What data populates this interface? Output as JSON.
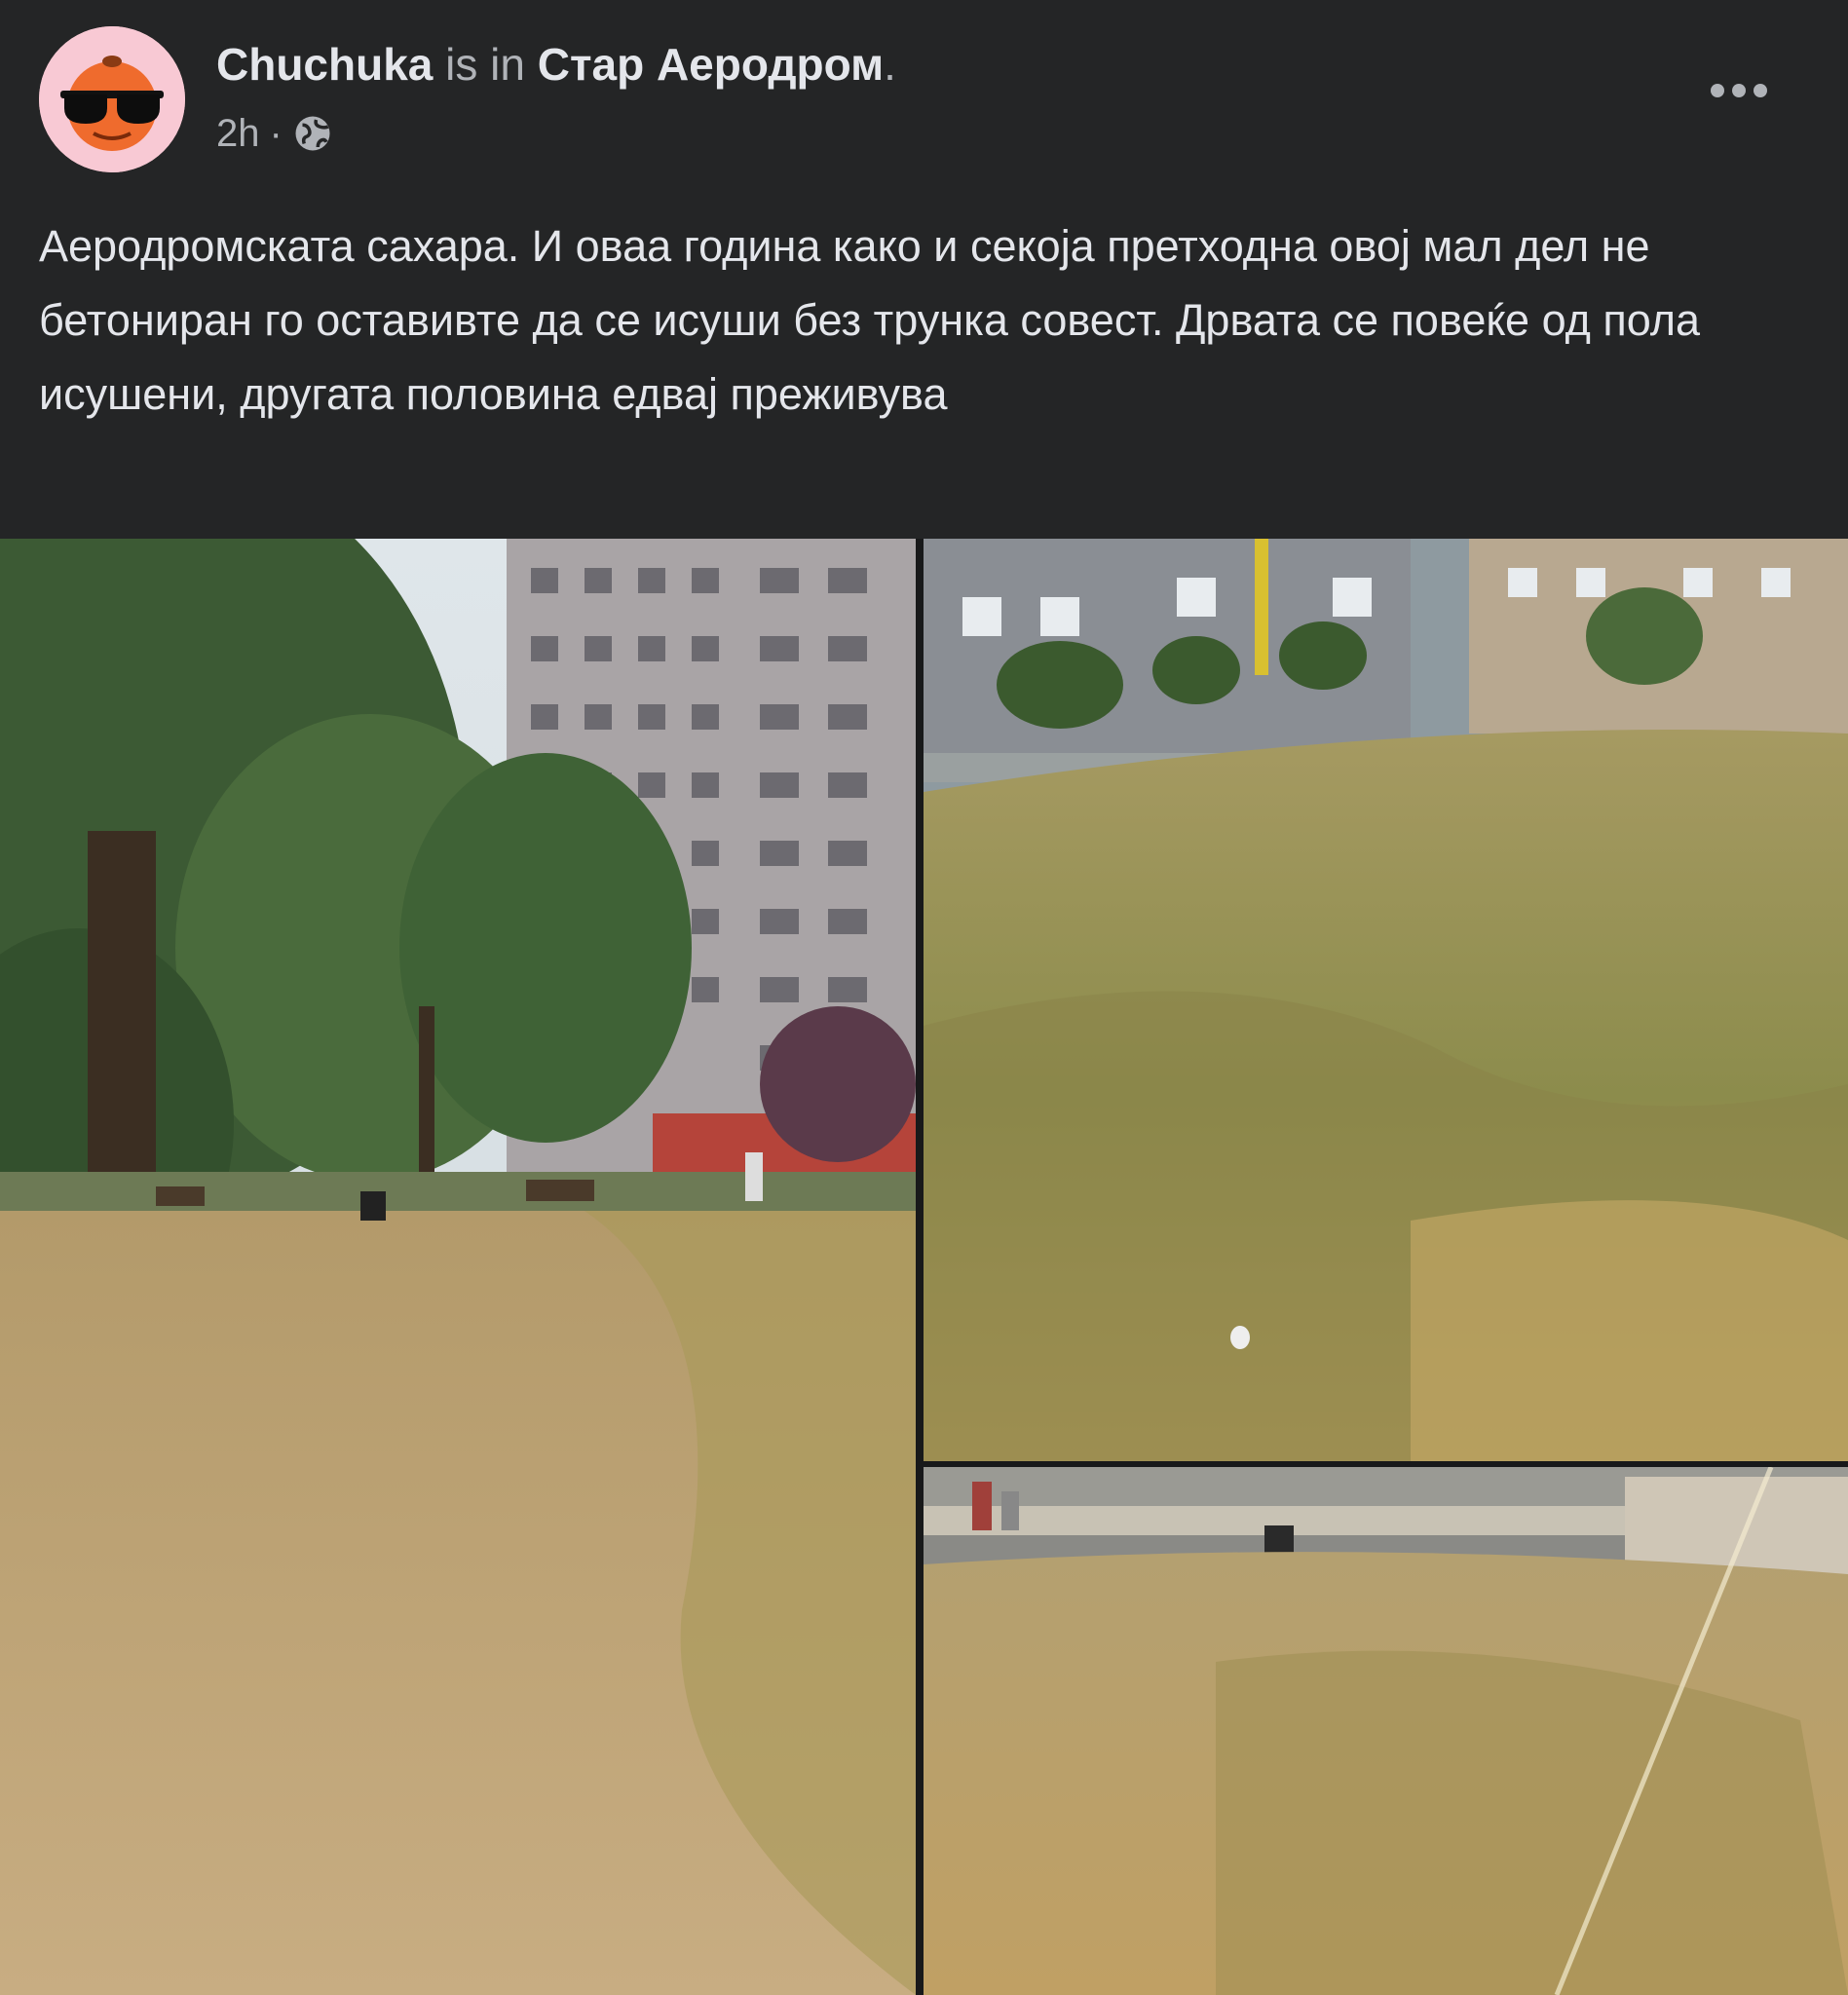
{
  "post": {
    "author": "Chuchuka",
    "is_in": "is in",
    "location": "Стар Аеродром",
    "location_end": ".",
    "timestamp": "2h",
    "separator": "·",
    "audience_icon": "globe-icon",
    "more_icon": "more-horizontal-icon",
    "avatar_icon": "orange-with-sunglasses-avatar",
    "text": "Аеродромската сахара. И оваа година како и секоја претходна овој мал дел не бетониран го оставивте да се исуши без трунка совест. Дрвата се повеќе од пола исушени, другата половина едвај преживува"
  },
  "photos": [
    {
      "description": "Park with trees, benches and tall apartment building; dry grass in foreground"
    },
    {
      "description": "Dry lawn in front of grey buildings with young trees"
    },
    {
      "description": "Dry grassy slope with path, bin and small structure"
    }
  ],
  "colors": {
    "background": "#242526",
    "text_primary": "#e4e6eb",
    "text_secondary": "#b0b3b8",
    "avatar_bg": "#f8c9d4"
  }
}
